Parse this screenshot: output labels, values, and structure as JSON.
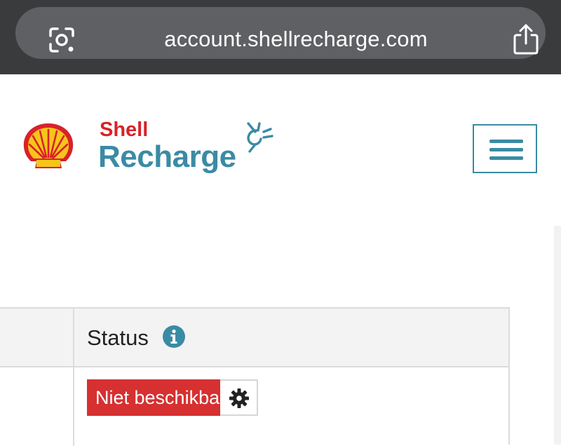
{
  "browser": {
    "url": "account.shellrecharge.com",
    "lens_icon": "lens-icon",
    "share_icon": "share-icon"
  },
  "header": {
    "logo_icon": "shell-pecten-icon",
    "brand_line1": "Shell",
    "brand_line2": "Recharge",
    "brand_icon": "plug-icon",
    "menu_icon": "hamburger-menu-icon"
  },
  "table": {
    "columns": [
      "",
      "Status"
    ],
    "status_info_icon": "info-icon",
    "rows": [
      {
        "status": "Niet beschikbaar",
        "settings_icon": "gear-icon"
      }
    ]
  },
  "colors": {
    "brand_red": "#d8222a",
    "brand_teal": "#3a8ba4",
    "status_red": "#d63031",
    "browser_bg": "#3a3b3d"
  }
}
